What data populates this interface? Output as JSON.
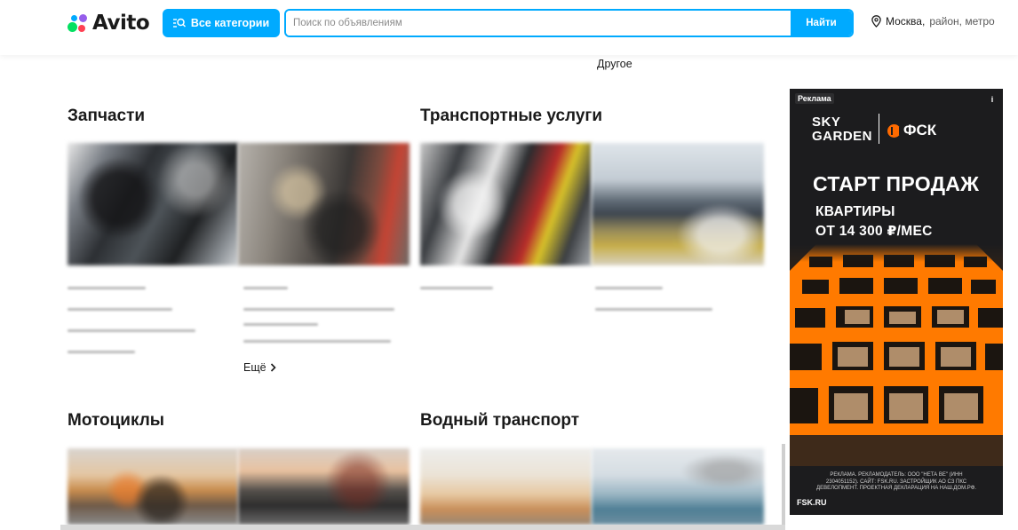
{
  "header": {
    "logo_text": "Avito",
    "categories_label": "Все категории",
    "search_placeholder": "Поиск по объявлениям",
    "search_value": "",
    "search_button": "Найти",
    "location_city": "Москва,",
    "location_region": "район, метро"
  },
  "top_link": "Другое",
  "sections": [
    {
      "title": "Запчасти"
    },
    {
      "title": "Транспортные услуги"
    },
    {
      "title": "Мотоциклы"
    },
    {
      "title": "Водный транспорт"
    }
  ],
  "more_label": "Ещё",
  "ad": {
    "label": "Реклама",
    "info": "i",
    "brand1": "SKY GARDEN",
    "brand2": "ФСК",
    "headline": "СТАРТ ПРОДАЖ",
    "sub1": "КВАРТИРЫ",
    "sub2": "ОТ 14 300 ₽/МЕС",
    "legal": "РЕКЛАМА. РЕКЛАМОДАТЕЛЬ: ООО \"НЕТА ВЕ\" (ИНН 2304051152). САЙТ: FSK.RU. ЗАСТРОЙЩИК АО СЗ ПКС ДЕВЕЛОПМЕНТ. ПРОЕКТНАЯ ДЕКЛАРАЦИЯ НА НАШ.ДОМ.РФ.",
    "site": "FSK.RU",
    "colors": {
      "background": "#1c1c1e",
      "accent": "#ff7a00"
    }
  },
  "colors": {
    "brand_blue": "#00aaff"
  },
  "icons": [
    "search-icon",
    "location-pin-icon",
    "chevron-right-icon",
    "info-icon"
  ]
}
